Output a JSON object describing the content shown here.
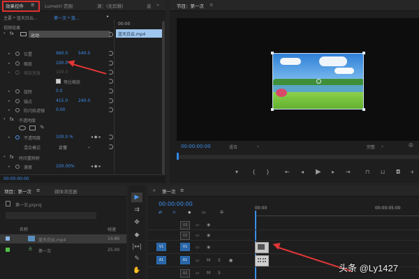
{
  "effect_controls": {
    "tabs": [
      "效果控件",
      "Lumetri 范围",
      "源：(无剪辑)"
    ],
    "tab_menu_icon": "≡",
    "tab_next": "音",
    "master_label": "主要 * 蓝天白云...",
    "sequence_label": "第一次 * 蓝...",
    "clip_tag": "蓝天白云.mp4",
    "time_mini": "00:00",
    "section_video": "视频效果",
    "motion_label": "运动",
    "position_label": "位置",
    "position_x": "960.0",
    "position_y": "540.0",
    "scale_label": "缩放",
    "scale_value": "100.0",
    "scale_width_label": "缩放宽度",
    "scale_width_value": "100.0",
    "uniform_scale_label": "等比缩放",
    "rotation_label": "旋转",
    "rotation_value": "0.0",
    "anchor_label": "锚点",
    "anchor_x": "415.0",
    "anchor_y": "240.0",
    "antiflicker_label": "防闪烁滤镜",
    "antiflicker_value": "0.00",
    "opacity_section": "不透明度",
    "opacity_label": "不透明度",
    "opacity_value": "100.0 %",
    "blend_label": "混合模式",
    "blend_value": "正常",
    "time_remap_section": "时间重映射",
    "speed_label": "速度",
    "speed_value": "100.00%",
    "footer_time": "00:00:00:00"
  },
  "program": {
    "title": "节目：第一次",
    "menu_icon": "≡",
    "timecode": "00:00:00:00",
    "fit_label": "适合",
    "quality_label": "完整",
    "colors": {
      "sky": "#4a97e0",
      "grass": "#7cc53a",
      "water": "#5aa6c9"
    }
  },
  "project": {
    "tabs": [
      "项目：第一次",
      "媒体浏览器"
    ],
    "tab_menu_icon": "≡",
    "file_label": "第一次.prproj",
    "col_name": "名称",
    "col_rate": "帧速",
    "items": [
      {
        "name": "蓝天白云.mp4",
        "rate": "14.86"
      },
      {
        "name": "第一次",
        "rate": "25.00"
      }
    ]
  },
  "timeline": {
    "sequence_tab": "第一次",
    "menu_icon": "≡",
    "close_icon": "×",
    "timecode": "00:00:00:00",
    "ruler_start": "00:00",
    "ruler_mid": "00:00:05:00",
    "tracks": [
      {
        "name": "V3",
        "target": ""
      },
      {
        "name": "V2",
        "target": ""
      },
      {
        "name": "V1",
        "target": "V1"
      },
      {
        "name": "A1",
        "target": "A1"
      },
      {
        "name": "A2",
        "target": ""
      }
    ]
  },
  "watermark": {
    "text": "头条 @Ly1427"
  }
}
